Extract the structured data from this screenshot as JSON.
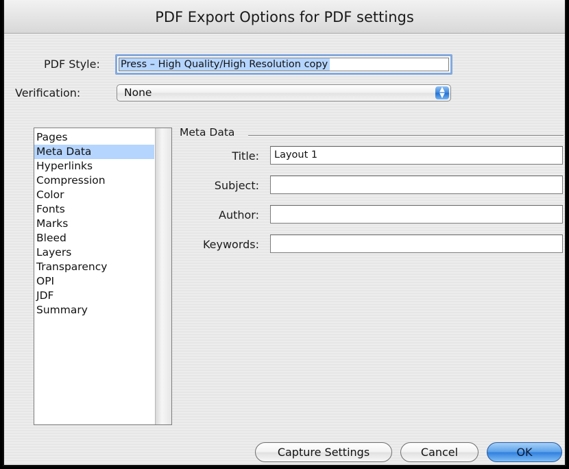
{
  "window": {
    "title": "PDF Export Options for PDF settings"
  },
  "pdf_style": {
    "label": "PDF Style:",
    "value": "Press – High Quality/High Resolution copy"
  },
  "verification": {
    "label": "Verification:",
    "value": "None"
  },
  "sidebar": {
    "items": [
      {
        "label": "Pages",
        "selected": false
      },
      {
        "label": "Meta Data",
        "selected": true
      },
      {
        "label": "Hyperlinks",
        "selected": false
      },
      {
        "label": "Compression",
        "selected": false
      },
      {
        "label": "Color",
        "selected": false
      },
      {
        "label": "Fonts",
        "selected": false
      },
      {
        "label": "Marks",
        "selected": false
      },
      {
        "label": "Bleed",
        "selected": false
      },
      {
        "label": "Layers",
        "selected": false
      },
      {
        "label": "Transparency",
        "selected": false
      },
      {
        "label": "OPI",
        "selected": false
      },
      {
        "label": "JDF",
        "selected": false
      },
      {
        "label": "Summary",
        "selected": false
      }
    ]
  },
  "meta_data": {
    "group_label": "Meta Data",
    "title_label": "Title:",
    "title_value": "Layout 1",
    "subject_label": "Subject:",
    "subject_value": "",
    "author_label": "Author:",
    "author_value": "",
    "keywords_label": "Keywords:",
    "keywords_value": ""
  },
  "buttons": {
    "capture_settings": "Capture Settings",
    "cancel": "Cancel",
    "ok": "OK"
  },
  "colors": {
    "selection": "#b5d5ff",
    "focus_ring": "#83a9dd",
    "default_button": "#3c86de"
  },
  "icons": {
    "popup_arrows": "up-down-arrows-icon"
  }
}
